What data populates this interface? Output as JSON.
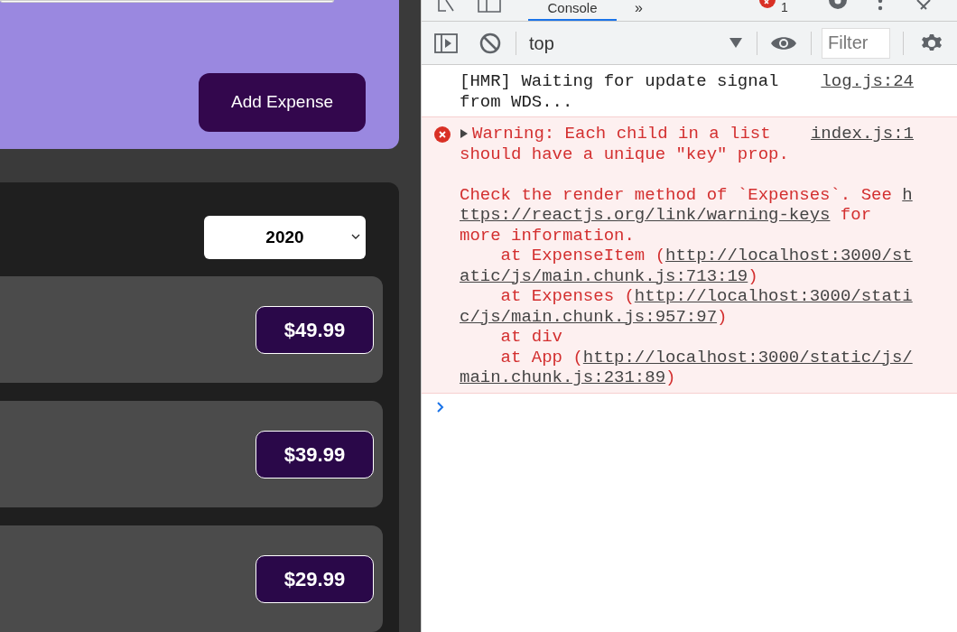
{
  "app": {
    "form": {
      "submit_button": "Add Expense"
    },
    "filter": {
      "value": "2020"
    },
    "expenses": [
      {
        "amount": "$49.99"
      },
      {
        "amount": "$39.99"
      },
      {
        "amount": "$29.99"
      }
    ]
  },
  "devtools": {
    "tabs": [
      {
        "label": "Console",
        "selected": true
      }
    ],
    "more_tabs": "»",
    "error_count": "1",
    "context": "top",
    "filter": {
      "placeholder": "Filter"
    },
    "messages": [
      {
        "kind": "log",
        "source": "log.js:24",
        "lines": [
          {
            "segments": [
              {
                "text": "[HMR] Waiting for update signal",
                "link": false
              }
            ]
          },
          {
            "segments": [
              {
                "text": "from WDS...",
                "link": false
              }
            ]
          }
        ]
      },
      {
        "kind": "error",
        "expanded": false,
        "source": "index.js:1",
        "lines": [
          {
            "segments": [
              {
                "text": "Warning: Each child in a list",
                "link": false
              }
            ]
          },
          {
            "segments": [
              {
                "text": "should have a unique \"key\" prop.",
                "link": false
              }
            ]
          },
          {
            "gap_before": true,
            "segments": [
              {
                "text": "Check the render method of `Expenses`. See ",
                "link": false
              },
              {
                "text": "h",
                "link": true
              }
            ]
          },
          {
            "segments": [
              {
                "text": "ttps://reactjs.org/link/warning-keys",
                "link": true
              },
              {
                "text": " for",
                "link": false
              }
            ]
          },
          {
            "segments": [
              {
                "text": "more information.",
                "link": false
              }
            ]
          },
          {
            "segments": [
              {
                "text": "    at ExpenseItem (",
                "link": false
              },
              {
                "text": "http://localhost:3000/st",
                "link": true
              }
            ]
          },
          {
            "segments": [
              {
                "text": "atic/js/main.chunk.js:713:19",
                "link": true
              },
              {
                "text": ")",
                "link": false
              }
            ]
          },
          {
            "segments": [
              {
                "text": "    at Expenses (",
                "link": false
              },
              {
                "text": "http://localhost:3000/stati",
                "link": true
              }
            ]
          },
          {
            "segments": [
              {
                "text": "c/js/main.chunk.js:957:97",
                "link": true
              },
              {
                "text": ")",
                "link": false
              }
            ]
          },
          {
            "segments": [
              {
                "text": "    at div",
                "link": false
              }
            ]
          },
          {
            "segments": [
              {
                "text": "    at App (",
                "link": false
              },
              {
                "text": "http://localhost:3000/static/js/",
                "link": true
              }
            ]
          },
          {
            "segments": [
              {
                "text": "main.chunk.js:231:89",
                "link": true
              },
              {
                "text": ")",
                "link": false
              }
            ]
          }
        ]
      }
    ]
  }
}
